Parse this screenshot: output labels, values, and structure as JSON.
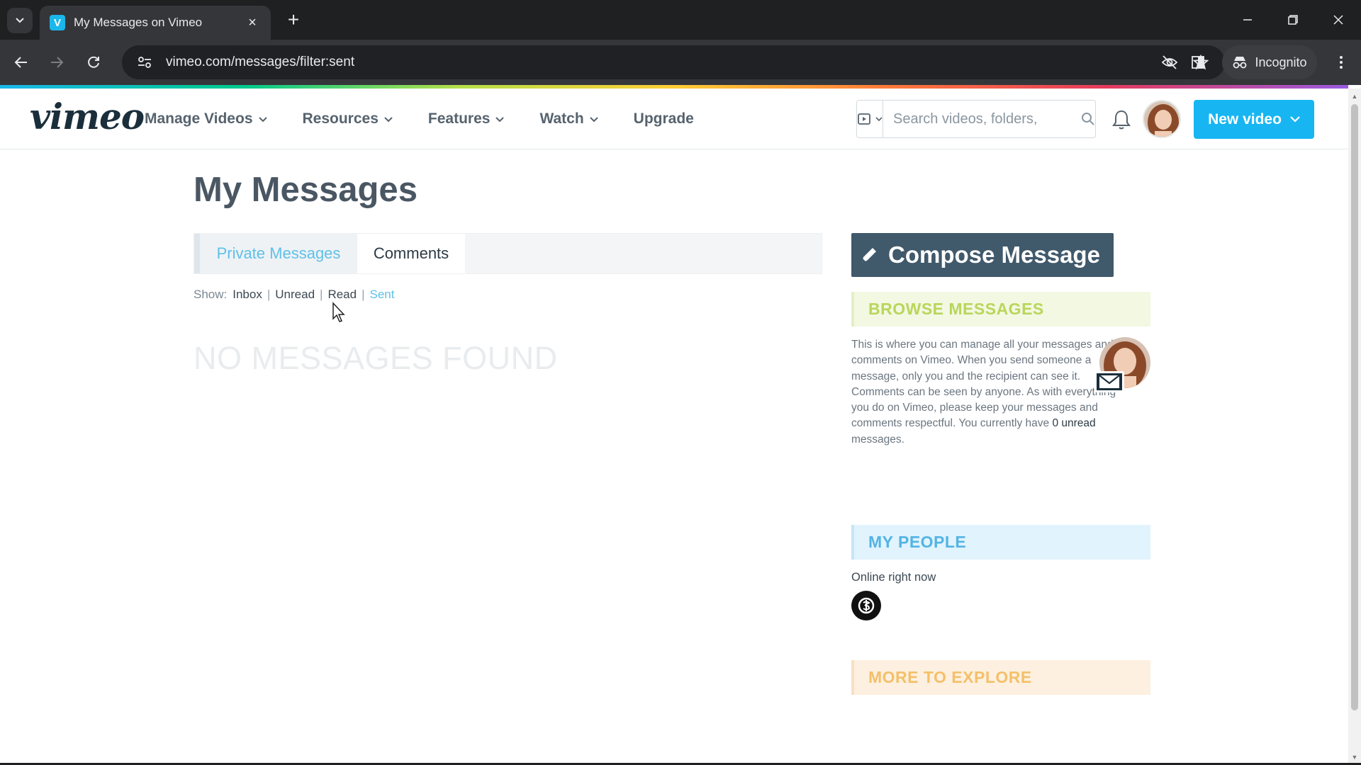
{
  "browser": {
    "tab_title": "My Messages on Vimeo",
    "tab_favicon": "V",
    "url": "vimeo.com/messages/filter:sent",
    "incognito_label": "Incognito",
    "new_tab_icon": "+",
    "close_tab_icon": "×"
  },
  "header": {
    "logo": "vimeo",
    "nav": [
      {
        "label": "Manage Videos",
        "has_dropdown": true
      },
      {
        "label": "Resources",
        "has_dropdown": true
      },
      {
        "label": "Features",
        "has_dropdown": true
      },
      {
        "label": "Watch",
        "has_dropdown": true
      },
      {
        "label": "Upgrade",
        "has_dropdown": false
      }
    ],
    "search_placeholder": "Search videos, folders,",
    "new_video_label": "New video",
    "accent_color": "#17b6f2"
  },
  "main": {
    "title": "My Messages",
    "tabs": [
      {
        "label": "Private Messages",
        "active": true
      },
      {
        "label": "Comments",
        "active": false
      }
    ],
    "filter": {
      "show_label": "Show:",
      "options": [
        "Inbox",
        "Unread",
        "Read",
        "Sent"
      ],
      "active": "Sent"
    },
    "empty_text": "NO MESSAGES FOUND"
  },
  "sidebar": {
    "compose_label": "Compose Message",
    "browse_title": "BROWSE MESSAGES",
    "browse_text": "This is where you can manage all your messages and comments on Vimeo. When you send someone a message, only you and the recipient can see it. Comments can be seen by anyone. As with everything you do on Vimeo, please keep your messages and comments respectful. You currently have",
    "unread_count_text": "0 unread",
    "browse_text_end": "messages.",
    "people_title": "MY PEOPLE",
    "online_label": "Online right now",
    "explore_title": "MORE TO EXPLORE"
  }
}
